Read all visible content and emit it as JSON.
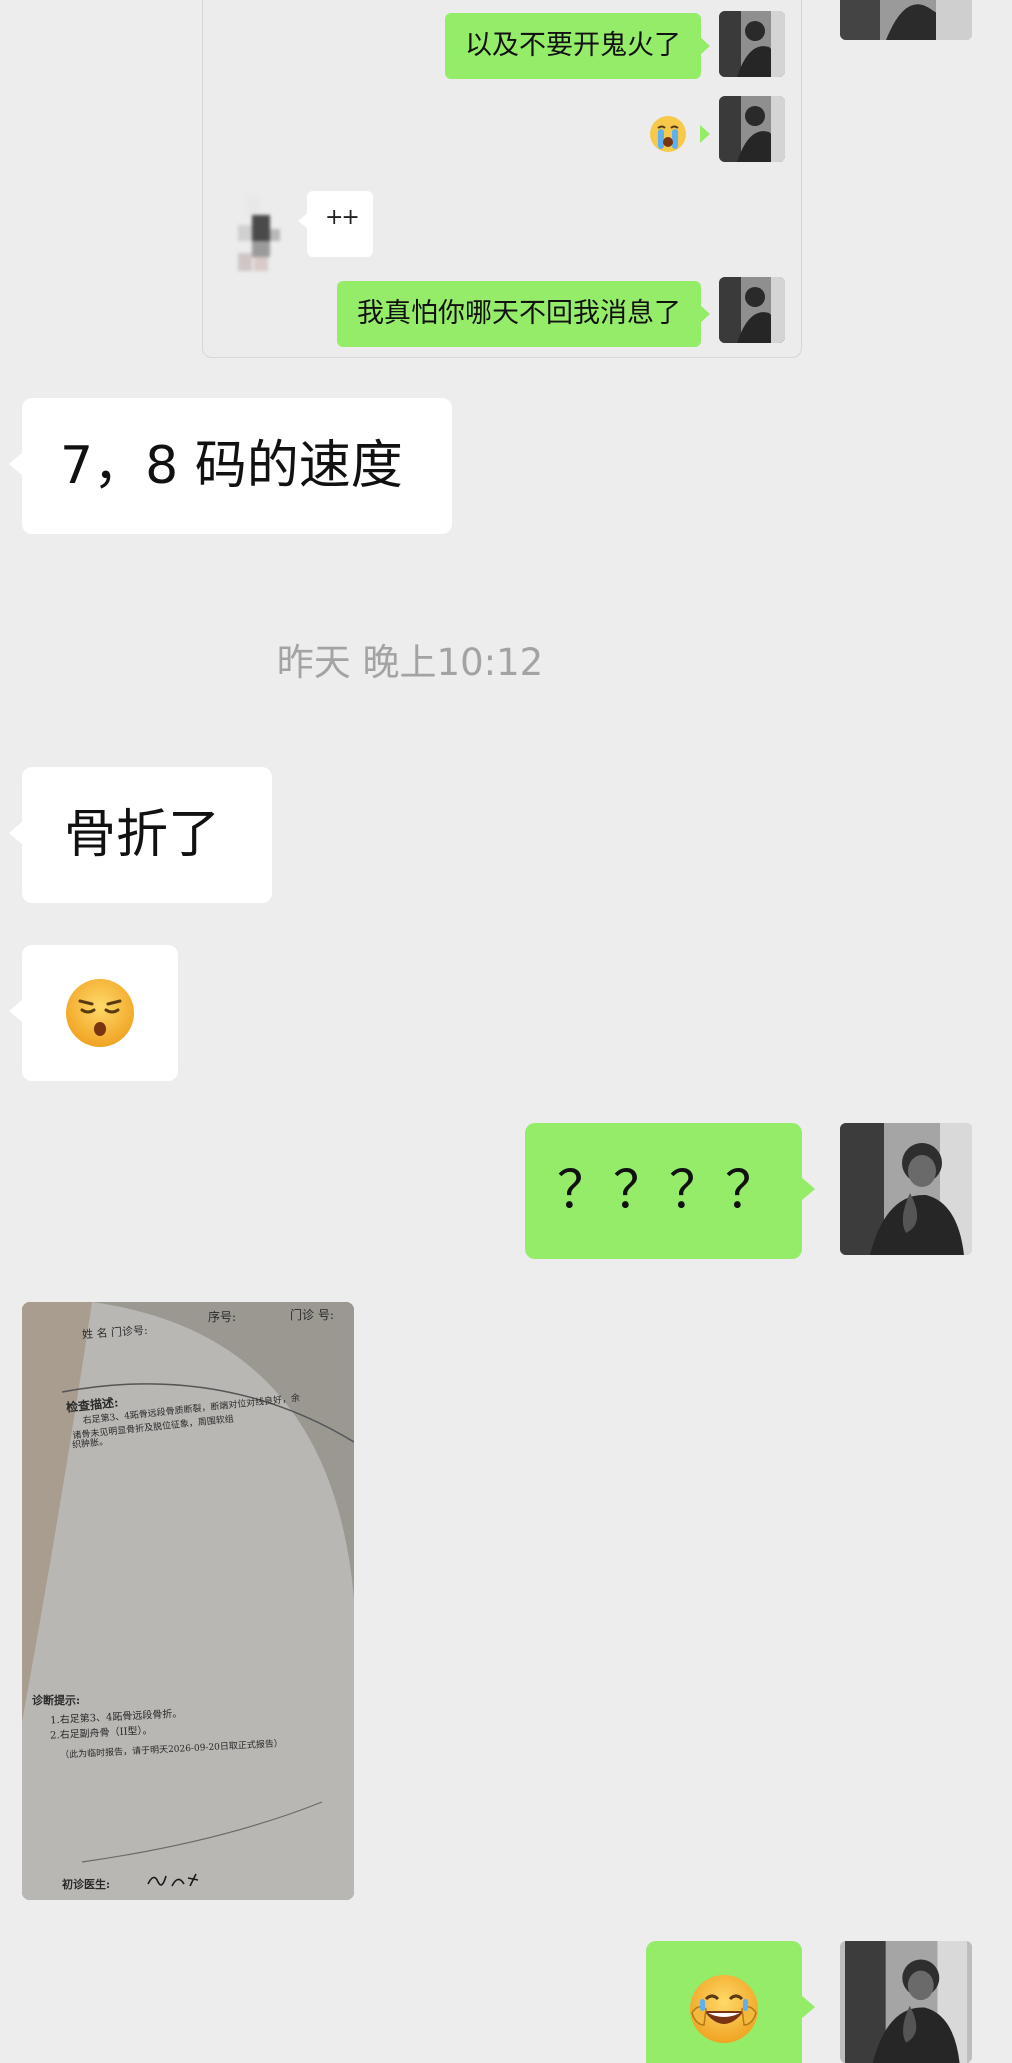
{
  "quoted_history": {
    "messages": [
      {
        "side": "out",
        "text": "以及不要开鬼火了"
      },
      {
        "side": "out",
        "emoji": "loudly-crying-face"
      },
      {
        "side": "in",
        "text": "++"
      },
      {
        "side": "out",
        "text": "我真怕你哪天不回我消息了"
      }
    ]
  },
  "chat": {
    "msg_speed": "7，8 码的速度",
    "timestamp": "昨天 晚上10:12",
    "msg_fracture": "骨折了",
    "msg_emoji_in": "sleepy-face",
    "msg_question": "？？？？",
    "msg_emoji_out": "rolling-on-the-floor-laughing-face"
  },
  "photo_document": {
    "header_left": "姓  名  门诊号:",
    "header_mid": "序号:",
    "header_right": "门诊  号:",
    "findings_title": "检查描述:",
    "findings_lines": [
      "右足第3、4跖骨远段骨质断裂，断端对位对线良好，余",
      "诸骨未见明显骨折及脱位征象，周围软组",
      "织肿胀。"
    ],
    "diagnosis_title": "诊断提示:",
    "diagnosis_lines": [
      "1.右足第3、4跖骨远段骨折。",
      "2.右足副舟骨（II型）。",
      "（此为临时报告，请于明天2026-09-20日取正式报告）"
    ],
    "doctor_label": "初诊医生:"
  },
  "colors": {
    "background": "#ededed",
    "outgoing_bubble": "#95ec69",
    "incoming_bubble": "#ffffff",
    "timestamp_text": "#a3a3a3"
  }
}
